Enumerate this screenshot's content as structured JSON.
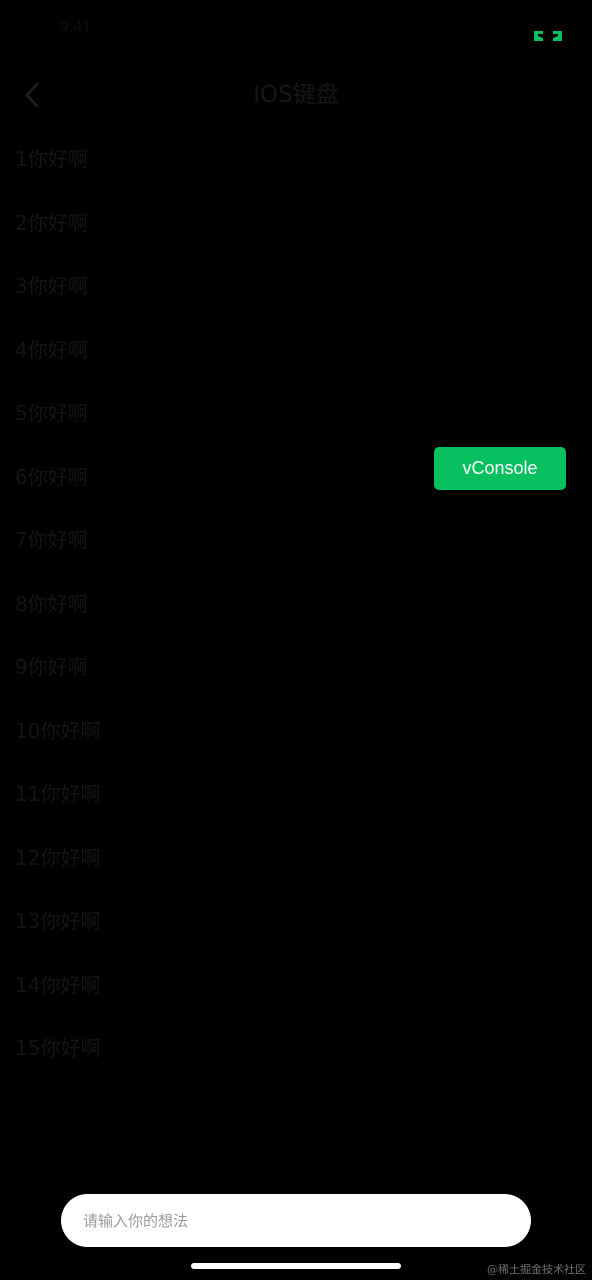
{
  "status_bar": {
    "time": "9:41",
    "fullscreen_icon": "fullscreen-toggle-icon",
    "accent_color": "#07c160"
  },
  "nav": {
    "back_icon": "chevron-left-icon",
    "title": "IOS键盘"
  },
  "list": {
    "items": [
      "1你好啊",
      "2你好啊",
      "3你好啊",
      "4你好啊",
      "5你好啊",
      "6你好啊",
      "7你好啊",
      "8你好啊",
      "9你好啊",
      "10你好啊",
      "11你好啊",
      "12你好啊",
      "13你好啊",
      "14你好啊",
      "15你好啊"
    ]
  },
  "vconsole": {
    "label": "vConsole",
    "color": "#07c160"
  },
  "input_bar": {
    "placeholder": "请输入你的想法",
    "value": ""
  },
  "watermark": {
    "text": "@稀土掘金技术社区"
  }
}
